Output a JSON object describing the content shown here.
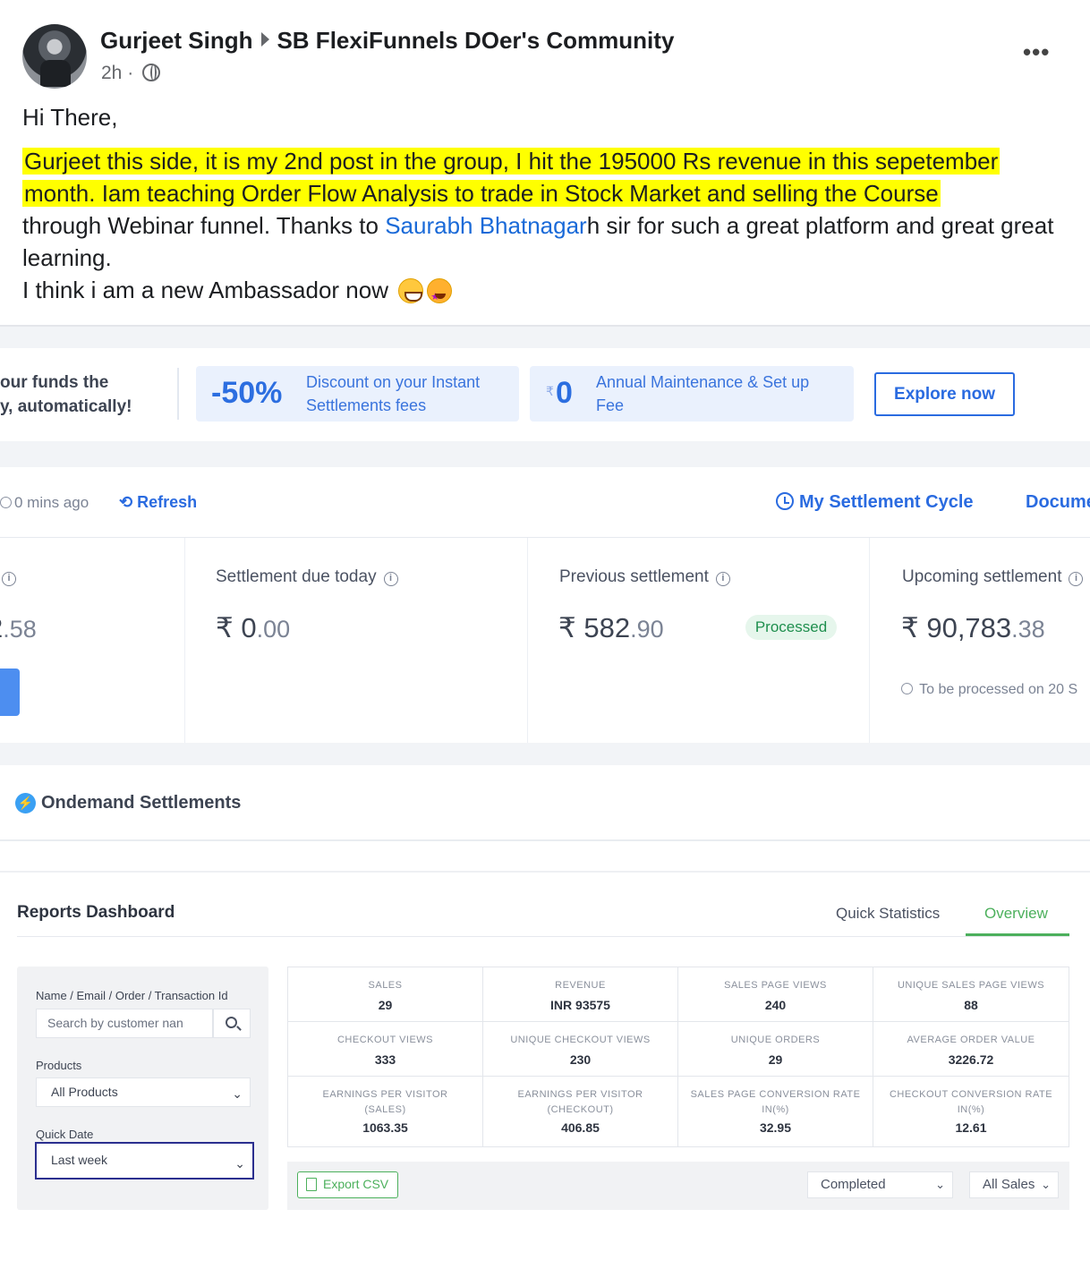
{
  "post": {
    "author": "Gurjeet Singh",
    "group": "SB FlexiFunnels DOer's Community",
    "time": "2h ·",
    "greeting": "Hi There,",
    "highlight_line1": "Gurjeet this side, it is my 2nd post in the group, I hit the 195000 Rs revenue in this sepetember",
    "highlight_line2": "month. Iam teaching Order Flow Analysis to trade in Stock Market and selling the Course",
    "body_before_link": "through Webinar funnel. Thanks to ",
    "mention": "Saurabh Bhatnagar",
    "body_after_link": "h sir for such a great platform and great great learning.",
    "closing": "I think i am a new Ambassador now ",
    "more_label": "•••"
  },
  "banner": {
    "left_text_line1": "our funds the",
    "left_text_line2": "y, automatically!",
    "promo1_big": "-50%",
    "promo1_line1": "Discount on your Instant",
    "promo1_line2": "Settlements fees",
    "promo2_currency": "₹",
    "promo2_big": "0",
    "promo2_line1": "Annual Maintenance & Set up",
    "promo2_line2": "Fee",
    "explore_label": "Explore now"
  },
  "settlement": {
    "updated": "0 mins ago",
    "refresh_label": "Refresh",
    "my_cycle_label": "My Settlement Cycle",
    "docs_label": "Docume",
    "col0_amount_int": "2",
    "col0_amount_dec": ".58",
    "due_label": "Settlement due today",
    "due_amount_int": "₹ 0",
    "due_amount_dec": ".00",
    "prev_label": "Previous settlement",
    "prev_amount_int": "₹ 582",
    "prev_amount_dec": ".90",
    "prev_status": "Processed",
    "upcoming_label": "Upcoming settlement",
    "upcoming_amount_int": "₹ 90,783",
    "upcoming_amount_dec": ".38",
    "upcoming_note": "To be processed on 20 S"
  },
  "ondemand": {
    "title": "Ondemand Settlements",
    "icon": "bolt-icon"
  },
  "reports": {
    "title": "Reports Dashboard",
    "tabs": [
      "Quick Statistics",
      "Overview"
    ],
    "active_tab": "Overview",
    "filters": {
      "search_label": "Name / Email / Order / Transaction Id",
      "search_placeholder": "Search by customer nan",
      "products_label": "Products",
      "products_value": "All Products",
      "quick_date_label": "Quick Date",
      "quick_date_value": "Last week"
    },
    "stats": [
      {
        "label": "SALES",
        "value": "29"
      },
      {
        "label": "REVENUE",
        "value": "INR 93575"
      },
      {
        "label": "SALES PAGE VIEWS",
        "value": "240"
      },
      {
        "label": "UNIQUE SALES PAGE VIEWS",
        "value": "88"
      },
      {
        "label": "CHECKOUT VIEWS",
        "value": "333"
      },
      {
        "label": "UNIQUE CHECKOUT VIEWS",
        "value": "230"
      },
      {
        "label": "UNIQUE ORDERS",
        "value": "29"
      },
      {
        "label": "AVERAGE ORDER VALUE",
        "value": "3226.72"
      },
      {
        "label": "EARNINGS PER VISITOR",
        "label2": "(SALES)",
        "value": "1063.35"
      },
      {
        "label": "EARNINGS PER VISITOR",
        "label2": "(CHECKOUT)",
        "value": "406.85"
      },
      {
        "label": "SALES PAGE CONVERSION RATE",
        "label2": "IN(%)",
        "value": "32.95"
      },
      {
        "label": "CHECKOUT CONVERSION RATE",
        "label2": "IN(%)",
        "value": "12.61"
      }
    ],
    "export_label": "Export CSV",
    "status_select": "Completed",
    "sales_select": "All Sales"
  },
  "colors": {
    "accent_blue": "#2a6be0",
    "green": "#4cb05c",
    "highlight": "#ffff00"
  }
}
